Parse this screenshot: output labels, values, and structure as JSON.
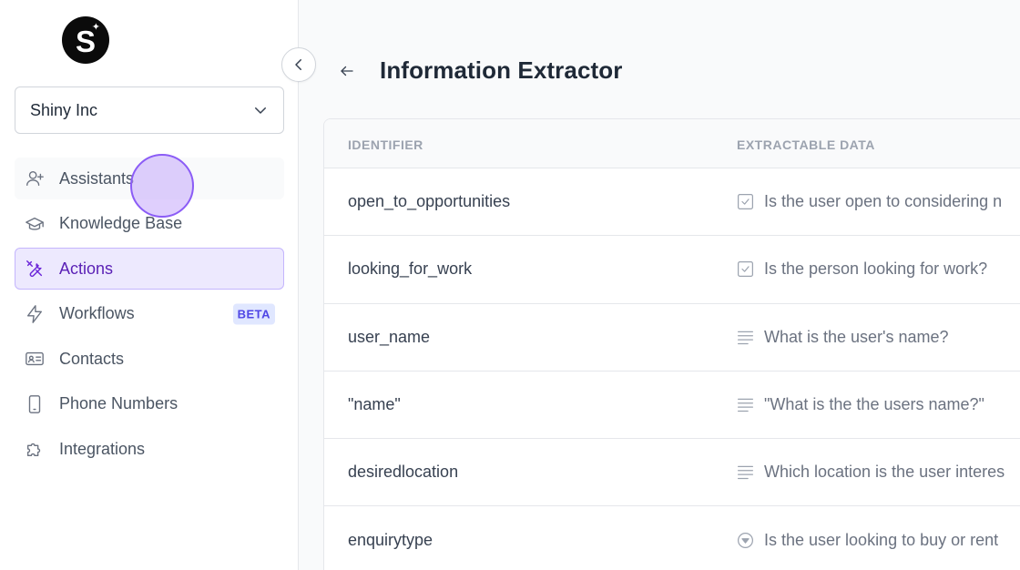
{
  "app": {
    "logo_letter": "S",
    "org_name": "Shiny Inc",
    "accent_color": "#7c3aed"
  },
  "sidebar": {
    "items": [
      {
        "label": "Assistants",
        "icon": "user-plus-icon",
        "state": "hover"
      },
      {
        "label": "Knowledge Base",
        "icon": "graduation-cap-icon",
        "state": "normal"
      },
      {
        "label": "Actions",
        "icon": "tools-icon",
        "state": "active"
      },
      {
        "label": "Workflows",
        "icon": "lightning-icon",
        "state": "normal",
        "badge": "BETA"
      },
      {
        "label": "Contacts",
        "icon": "contact-card-icon",
        "state": "normal"
      },
      {
        "label": "Phone Numbers",
        "icon": "phone-icon",
        "state": "normal"
      },
      {
        "label": "Integrations",
        "icon": "puzzle-icon",
        "state": "normal"
      }
    ]
  },
  "main": {
    "title": "Information Extractor",
    "table": {
      "headers": [
        "IDENTIFIER",
        "EXTRACTABLE DATA"
      ],
      "rows": [
        {
          "identifier": "open_to_opportunities",
          "type_icon": "checkbox-icon",
          "data": "Is the user open to considering n"
        },
        {
          "identifier": "looking_for_work",
          "type_icon": "checkbox-icon",
          "data": "Is the person looking for work?"
        },
        {
          "identifier": "user_name",
          "type_icon": "text-lines-icon",
          "data": "What is the user's name?"
        },
        {
          "identifier": "\"name\"",
          "type_icon": "text-lines-icon",
          "data": "\"What is the the users name?\""
        },
        {
          "identifier": "desiredlocation",
          "type_icon": "text-lines-icon",
          "data": "Which location is the user interes"
        },
        {
          "identifier": "enquirytype",
          "type_icon": "dropdown-circle-icon",
          "data": "Is the user looking to buy or rent"
        }
      ]
    }
  }
}
